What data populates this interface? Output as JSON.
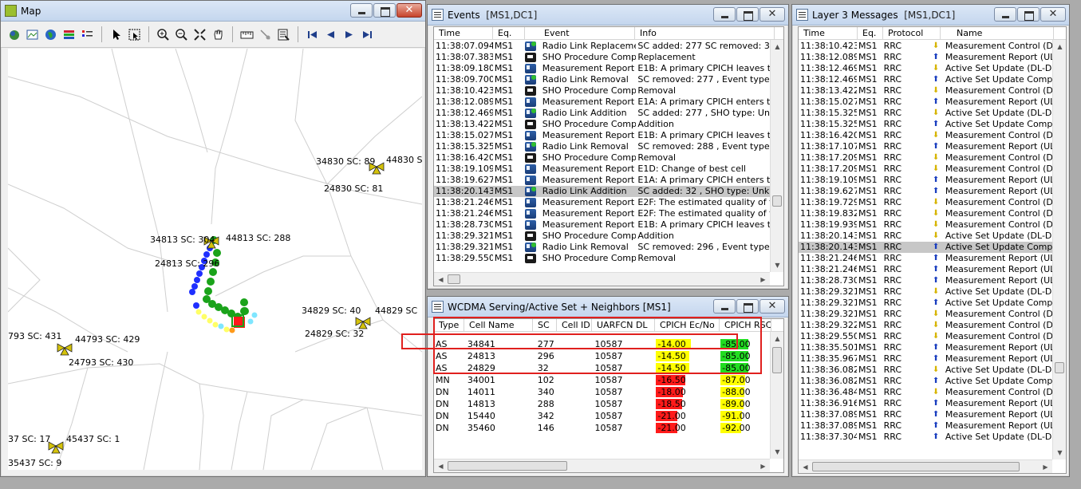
{
  "map_window": {
    "title": "Map",
    "toolbar_icons": [
      "layers-icon",
      "map-icon",
      "globe-icon",
      "stack-icon",
      "legend-icon",
      "pointer-icon",
      "select-box-icon",
      "zoom-in-icon",
      "zoom-out-icon",
      "fit-icon",
      "pan-icon",
      "ruler-icon",
      "route-icon",
      "properties-icon",
      "first-icon",
      "prev-icon",
      "next-icon",
      "last-icon"
    ],
    "site_labels": [
      {
        "id": "l1",
        "text": "34830 SC: 89"
      },
      {
        "id": "l2",
        "text": "44830 S"
      },
      {
        "id": "l3",
        "text": "24830 SC: 81"
      },
      {
        "id": "l4",
        "text": "34813 SC: 304"
      },
      {
        "id": "l5",
        "text": "44813 SC: 288"
      },
      {
        "id": "l6",
        "text": "24813 SC: 296"
      },
      {
        "id": "l7",
        "text": "34829 SC: 40"
      },
      {
        "id": "l8",
        "text": "44829 SC"
      },
      {
        "id": "l9",
        "text": "24829 SC: 32"
      },
      {
        "id": "l10",
        "text": "793 SC: 431"
      },
      {
        "id": "l11",
        "text": "44793 SC: 429"
      },
      {
        "id": "l12",
        "text": "24793 SC: 430"
      },
      {
        "id": "l13",
        "text": "37 SC: 17"
      },
      {
        "id": "l14",
        "text": "45437 SC: 1"
      },
      {
        "id": "l15",
        "text": "35437 SC: 9"
      }
    ]
  },
  "events_window": {
    "title": "Events",
    "subtitle": "[MS1,DC1]",
    "columns": [
      "Time",
      "Eq.",
      "Event",
      "Info"
    ],
    "rows": [
      {
        "time": "11:38:07.094",
        "eq": "MS1",
        "icon": "phone-green",
        "event": "Radio Link Replacement",
        "info": "SC added: 277 SC removed: 340 , S"
      },
      {
        "time": "11:38:07.383",
        "eq": "MS1",
        "icon": "gear",
        "event": "SHO Procedure Compl...",
        "info": "Replacement"
      },
      {
        "time": "11:38:09.180",
        "eq": "MS1",
        "icon": "phone",
        "event": "Measurement Report 1",
        "info": "E1B: A primary CPICH leaves the rep"
      },
      {
        "time": "11:38:09.700",
        "eq": "MS1",
        "icon": "phone-green",
        "event": "Radio Link Removal",
        "info": "SC removed: 277 , Event type: e1b"
      },
      {
        "time": "11:38:10.423",
        "eq": "MS1",
        "icon": "gear",
        "event": "SHO Procedure Compl...",
        "info": "Removal"
      },
      {
        "time": "11:38:12.089",
        "eq": "MS1",
        "icon": "phone",
        "event": "Measurement Report 1",
        "info": "E1A: A primary CPICH enters the rep"
      },
      {
        "time": "11:38:12.469",
        "eq": "MS1",
        "icon": "phone-green",
        "event": "Radio Link Addition",
        "info": "SC added: 277 , SHO type: Unknow"
      },
      {
        "time": "11:38:13.422",
        "eq": "MS1",
        "icon": "gear",
        "event": "SHO Procedure Compl...",
        "info": "Addition"
      },
      {
        "time": "11:38:15.027",
        "eq": "MS1",
        "icon": "phone",
        "event": "Measurement Report 1",
        "info": "E1B: A primary CPICH leaves the rep"
      },
      {
        "time": "11:38:15.325",
        "eq": "MS1",
        "icon": "phone-green",
        "event": "Radio Link Removal",
        "info": "SC removed: 288 , Event type: e1b"
      },
      {
        "time": "11:38:16.420",
        "eq": "MS1",
        "icon": "gear",
        "event": "SHO Procedure Compl...",
        "info": "Removal"
      },
      {
        "time": "11:38:19.109",
        "eq": "MS1",
        "icon": "phone",
        "event": "Measurement Report 1",
        "info": "E1D: Change of best cell"
      },
      {
        "time": "11:38:19.627",
        "eq": "MS1",
        "icon": "phone",
        "event": "Measurement Report 1",
        "info": "E1A: A primary CPICH enters the rep"
      },
      {
        "time": "11:38:20.143",
        "eq": "MS1",
        "icon": "phone-green",
        "event": "Radio Link Addition",
        "info": "SC added: 32 , SHO type: Unknown",
        "selected": true
      },
      {
        "time": "11:38:21.246",
        "eq": "MS1",
        "icon": "phone",
        "event": "Measurement Report 2",
        "info": "E2F: The estimated quality of the cu"
      },
      {
        "time": "11:38:21.246",
        "eq": "MS1",
        "icon": "phone",
        "event": "Measurement Report 2",
        "info": "E2F: The estimated quality of the cu"
      },
      {
        "time": "11:38:28.730",
        "eq": "MS1",
        "icon": "phone",
        "event": "Measurement Report 1",
        "info": "E1B: A primary CPICH leaves the rep"
      },
      {
        "time": "11:38:29.321",
        "eq": "MS1",
        "icon": "gear",
        "event": "SHO Procedure Compl...",
        "info": "Addition"
      },
      {
        "time": "11:38:29.321",
        "eq": "MS1",
        "icon": "phone-green",
        "event": "Radio Link Removal",
        "info": "SC removed: 296 , Event type: e1b"
      },
      {
        "time": "11:38:29.550",
        "eq": "MS1",
        "icon": "gear",
        "event": "SHO Procedure Compl...",
        "info": "Removal"
      }
    ]
  },
  "wcdma_window": {
    "title": "WCDMA Serving/Active Set + Neighbors [MS1]",
    "columns": [
      "Type",
      "Cell Name",
      "SC",
      "Cell ID",
      "UARFCN DL",
      "CPICH Ec/No",
      "CPICH RSCP"
    ],
    "rows": [
      {
        "type": "AS",
        "cell": "34841",
        "sc": "277",
        "cellid": "",
        "uarfcn": "10587",
        "ecno": "-14.00",
        "ecno_color": "#ffff00",
        "ecno_fill": 0.55,
        "rscp": "-85.00",
        "rscp_color": "#22dd22",
        "rscp_fill": 0.88
      },
      {
        "type": "AS",
        "cell": "24813",
        "sc": "296",
        "cellid": "",
        "uarfcn": "10587",
        "ecno": "-14.50",
        "ecno_color": "#ffff00",
        "ecno_fill": 0.52,
        "rscp": "-85.00",
        "rscp_color": "#22dd22",
        "rscp_fill": 0.88
      },
      {
        "type": "AS",
        "cell": "24829",
        "sc": "32",
        "cellid": "",
        "uarfcn": "10587",
        "ecno": "-14.50",
        "ecno_color": "#ffff00",
        "ecno_fill": 0.52,
        "rscp": "-85.00",
        "rscp_color": "#22dd22",
        "rscp_fill": 0.88
      },
      {
        "type": "MN",
        "cell": "34001",
        "sc": "102",
        "cellid": "",
        "uarfcn": "10587",
        "ecno": "-16.50",
        "ecno_color": "#ff1a1a",
        "ecno_fill": 0.46,
        "rscp": "-87.00",
        "rscp_color": "#ffff00",
        "rscp_fill": 0.78
      },
      {
        "type": "DN",
        "cell": "14011",
        "sc": "340",
        "cellid": "",
        "uarfcn": "10587",
        "ecno": "-18.00",
        "ecno_color": "#ff1a1a",
        "ecno_fill": 0.42,
        "rscp": "-88.00",
        "rscp_color": "#ffff00",
        "rscp_fill": 0.75
      },
      {
        "type": "DN",
        "cell": "14813",
        "sc": "288",
        "cellid": "",
        "uarfcn": "10587",
        "ecno": "-18.50",
        "ecno_color": "#ff1a1a",
        "ecno_fill": 0.41,
        "rscp": "-89.00",
        "rscp_color": "#ffff00",
        "rscp_fill": 0.72
      },
      {
        "type": "DN",
        "cell": "15440",
        "sc": "342",
        "cellid": "",
        "uarfcn": "10587",
        "ecno": "-21.00",
        "ecno_color": "#ff1a1a",
        "ecno_fill": 0.34,
        "rscp": "-91.00",
        "rscp_color": "#ffff00",
        "rscp_fill": 0.67
      },
      {
        "type": "DN",
        "cell": "35460",
        "sc": "146",
        "cellid": "",
        "uarfcn": "10587",
        "ecno": "-21.00",
        "ecno_color": "#ff1a1a",
        "ecno_fill": 0.34,
        "rscp": "-92.00",
        "rscp_color": "#ffff00",
        "rscp_fill": 0.64
      }
    ]
  },
  "l3_window": {
    "title": "Layer 3 Messages",
    "subtitle": "[MS1,DC1]",
    "columns": [
      "Time",
      "Eq.",
      "Protocol",
      "Name"
    ],
    "rows": [
      {
        "time": "11:38:10.423",
        "eq": "MS1",
        "proto": "RRC",
        "dir": "down",
        "name": "Measurement Control (DL-DC"
      },
      {
        "time": "11:38:12.089",
        "eq": "MS1",
        "proto": "RRC",
        "dir": "up",
        "name": "Measurement Report (UL-DC"
      },
      {
        "time": "11:38:12.469",
        "eq": "MS1",
        "proto": "RRC",
        "dir": "down",
        "name": "Active Set Update (DL-DCCH"
      },
      {
        "time": "11:38:12.469",
        "eq": "MS1",
        "proto": "RRC",
        "dir": "up",
        "name": "Active Set Update Complete"
      },
      {
        "time": "11:38:13.422",
        "eq": "MS1",
        "proto": "RRC",
        "dir": "down",
        "name": "Measurement Control (DL-DC"
      },
      {
        "time": "11:38:15.027",
        "eq": "MS1",
        "proto": "RRC",
        "dir": "up",
        "name": "Measurement Report (UL-DC"
      },
      {
        "time": "11:38:15.325",
        "eq": "MS1",
        "proto": "RRC",
        "dir": "down",
        "name": "Active Set Update (DL-DCCH"
      },
      {
        "time": "11:38:15.325",
        "eq": "MS1",
        "proto": "RRC",
        "dir": "up",
        "name": "Active Set Update Complete"
      },
      {
        "time": "11:38:16.420",
        "eq": "MS1",
        "proto": "RRC",
        "dir": "down",
        "name": "Measurement Control (DL-DC"
      },
      {
        "time": "11:38:17.107",
        "eq": "MS1",
        "proto": "RRC",
        "dir": "up",
        "name": "Measurement Report (UL-DC"
      },
      {
        "time": "11:38:17.209",
        "eq": "MS1",
        "proto": "RRC",
        "dir": "down",
        "name": "Measurement Control (DL-DC"
      },
      {
        "time": "11:38:17.209",
        "eq": "MS1",
        "proto": "RRC",
        "dir": "down",
        "name": "Measurement Control (DL-DC"
      },
      {
        "time": "11:38:19.109",
        "eq": "MS1",
        "proto": "RRC",
        "dir": "up",
        "name": "Measurement Report (UL-DC"
      },
      {
        "time": "11:38:19.627",
        "eq": "MS1",
        "proto": "RRC",
        "dir": "up",
        "name": "Measurement Report (UL-DC"
      },
      {
        "time": "11:38:19.729",
        "eq": "MS1",
        "proto": "RRC",
        "dir": "down",
        "name": "Measurement Control (DL-DC"
      },
      {
        "time": "11:38:19.832",
        "eq": "MS1",
        "proto": "RRC",
        "dir": "down",
        "name": "Measurement Control (DL-DC"
      },
      {
        "time": "11:38:19.939",
        "eq": "MS1",
        "proto": "RRC",
        "dir": "down",
        "name": "Measurement Control (DL-DC"
      },
      {
        "time": "11:38:20.143",
        "eq": "MS1",
        "proto": "RRC",
        "dir": "down",
        "name": "Active Set Update (DL-DCCH"
      },
      {
        "time": "11:38:20.143",
        "eq": "MS1",
        "proto": "RRC",
        "dir": "up",
        "name": "Active Set Update Complete",
        "selected": true
      },
      {
        "time": "11:38:21.246",
        "eq": "MS1",
        "proto": "RRC",
        "dir": "up",
        "name": "Measurement Report (UL-DC"
      },
      {
        "time": "11:38:21.246",
        "eq": "MS1",
        "proto": "RRC",
        "dir": "up",
        "name": "Measurement Report (UL-DC"
      },
      {
        "time": "11:38:28.730",
        "eq": "MS1",
        "proto": "RRC",
        "dir": "up",
        "name": "Measurement Report (UL-DC"
      },
      {
        "time": "11:38:29.321",
        "eq": "MS1",
        "proto": "RRC",
        "dir": "down",
        "name": "Active Set Update (DL-DCCH"
      },
      {
        "time": "11:38:29.321",
        "eq": "MS1",
        "proto": "RRC",
        "dir": "up",
        "name": "Active Set Update Complete"
      },
      {
        "time": "11:38:29.321",
        "eq": "MS1",
        "proto": "RRC",
        "dir": "down",
        "name": "Measurement Control (DL-DC"
      },
      {
        "time": "11:38:29.322",
        "eq": "MS1",
        "proto": "RRC",
        "dir": "down",
        "name": "Measurement Control (DL-DC"
      },
      {
        "time": "11:38:29.550",
        "eq": "MS1",
        "proto": "RRC",
        "dir": "down",
        "name": "Measurement Control (DL-DC"
      },
      {
        "time": "11:38:35.501",
        "eq": "MS1",
        "proto": "RRC",
        "dir": "up",
        "name": "Measurement Report (UL-DC"
      },
      {
        "time": "11:38:35.967",
        "eq": "MS1",
        "proto": "RRC",
        "dir": "up",
        "name": "Measurement Report (UL-DC"
      },
      {
        "time": "11:38:36.082",
        "eq": "MS1",
        "proto": "RRC",
        "dir": "down",
        "name": "Active Set Update (DL-DCCH"
      },
      {
        "time": "11:38:36.082",
        "eq": "MS1",
        "proto": "RRC",
        "dir": "up",
        "name": "Active Set Update Complete"
      },
      {
        "time": "11:38:36.484",
        "eq": "MS1",
        "proto": "RRC",
        "dir": "down",
        "name": "Measurement Control (DL-DC"
      },
      {
        "time": "11:38:36.916",
        "eq": "MS1",
        "proto": "RRC",
        "dir": "up",
        "name": "Measurement Report (UL-DC"
      },
      {
        "time": "11:38:37.089",
        "eq": "MS1",
        "proto": "RRC",
        "dir": "up",
        "name": "Measurement Report (UL-DC"
      },
      {
        "time": "11:38:37.089",
        "eq": "MS1",
        "proto": "RRC",
        "dir": "up",
        "name": "Measurement Report (UL-DC"
      },
      {
        "time": "11:38:37.304",
        "eq": "MS1",
        "proto": "RRC",
        "dir": "up",
        "name": "Active Set Update (DL-DCCH"
      }
    ]
  }
}
